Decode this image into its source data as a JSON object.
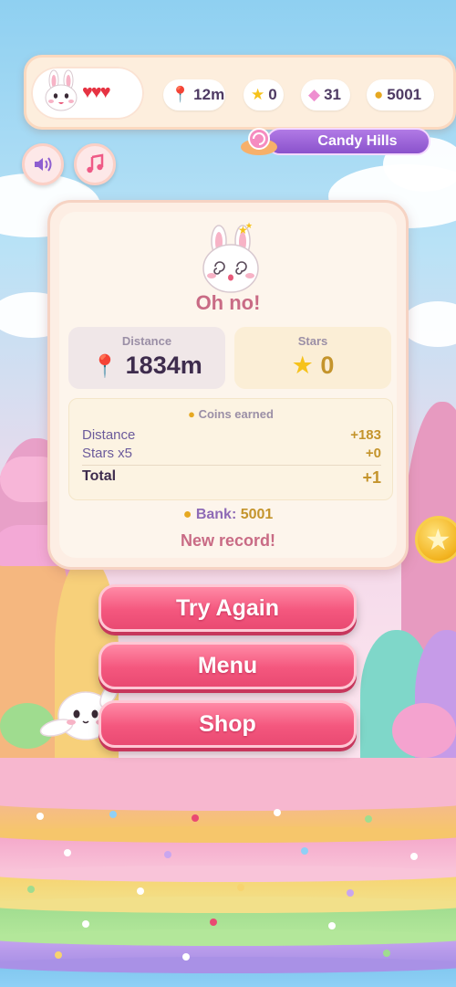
{
  "hud": {
    "hearts": "♥♥♥",
    "distance": "12m",
    "stars": "0",
    "gems": "31",
    "coins": "5001",
    "level_name": "Candy Hills"
  },
  "card": {
    "title": "Oh no!",
    "distance_label": "Distance",
    "distance_value": "1834m",
    "stars_label": "Stars",
    "stars_value": "0",
    "coins_earned_label": "Coins earned",
    "rows": [
      {
        "label": "Distance",
        "value": "+183"
      },
      {
        "label": "Stars x5",
        "value": "+0"
      },
      {
        "label": "Total",
        "value": "+1"
      }
    ],
    "bank_label": "Bank:",
    "bank_value": "5001",
    "record": "New record!"
  },
  "buttons": {
    "try_again": "Try Again",
    "menu": "Menu",
    "shop": "Shop"
  },
  "icons": {
    "sound": "speaker-icon",
    "music": "music-note-icon",
    "distance": "map-pin-icon",
    "star": "star-icon",
    "gem": "gem-icon",
    "coin": "coin-icon"
  },
  "colors": {
    "accent_pink": "#f4577e",
    "level_purple": "#9b5fd8",
    "coin_gold": "#c4942c",
    "title_pink": "#c96b85"
  }
}
